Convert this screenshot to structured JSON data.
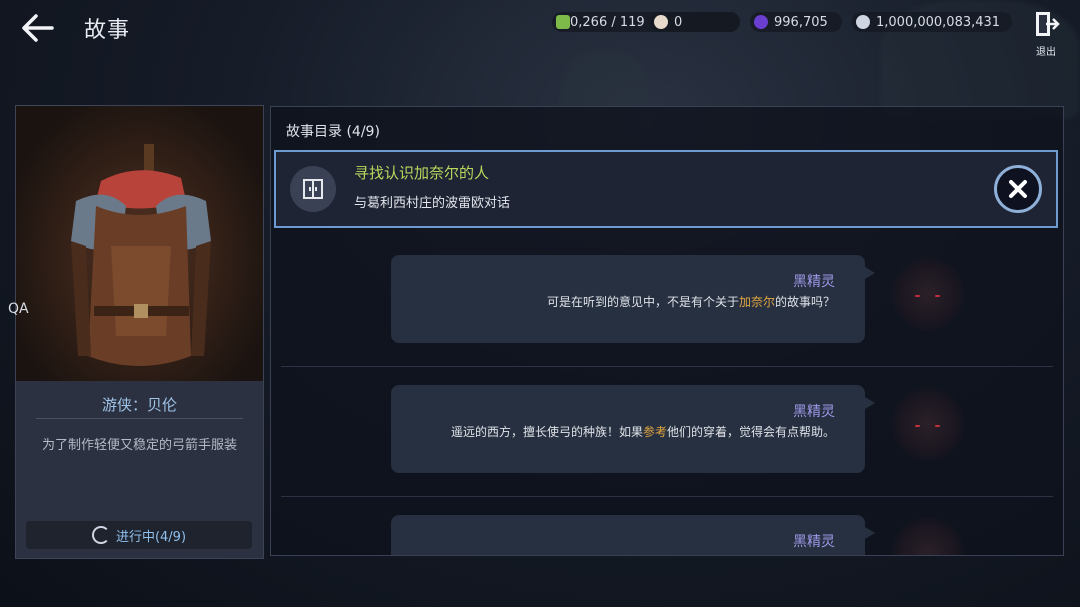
{
  "header": {
    "title": "故事",
    "exit_label": "退出"
  },
  "currencies": [
    {
      "name": "energy",
      "value": "0,266 / 119",
      "color": "#7dba4a"
    },
    {
      "name": "pearl",
      "value": "0",
      "color": "#e7d9cc"
    },
    {
      "name": "dark-orb",
      "value": "996,705",
      "color": "#6a3fd0"
    },
    {
      "name": "silver",
      "value": "1,000,000,083,431",
      "color": "#cfd6e2"
    }
  ],
  "character": {
    "name": "游侠：贝伦",
    "description": "为了制作轻便又稳定的弓箭手服装",
    "progress": "进行中(4/9)",
    "qa_label": "QA"
  },
  "story": {
    "header": "故事目录 (4/9)",
    "quest_title": "寻找认识加奈尔的人",
    "quest_sub": "与葛利西村庄的波雷欧对话",
    "dialogues": [
      {
        "speaker": "黑精灵",
        "before": "可是在听到的意见中，不是有个关于",
        "highlight": "加奈尔",
        "after": "的故事吗？"
      },
      {
        "speaker": "黑精灵",
        "before": "遥远的西方，擅长使弓的种族！如果",
        "highlight": "参考",
        "after": "他们的穿着，觉得会有点帮助。"
      },
      {
        "speaker": "黑精灵",
        "before": "",
        "highlight": "",
        "after": ""
      }
    ]
  },
  "colors": {
    "accent_border": "#6d9ad0",
    "quest_title": "#b8d85c",
    "speaker": "#9e98e8",
    "highlight": "#e0a640",
    "progress_text": "#8fc0ee"
  }
}
